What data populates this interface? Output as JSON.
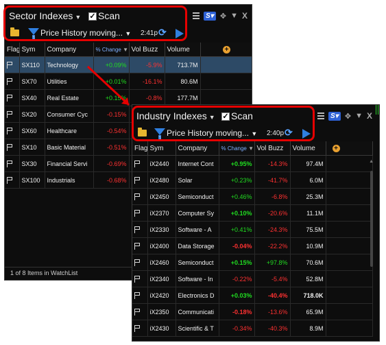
{
  "sector": {
    "title": "Sector Indexes",
    "scan_label": "Scan",
    "scan_checked": true,
    "filter_label": "Price History moving...",
    "filter_count": "1",
    "time": "2:41p",
    "columns": [
      "Flag",
      "Sym",
      "Company",
      "% Change",
      "Vol Buzz",
      "Volume"
    ],
    "sorted_column": "% Change",
    "rows": [
      {
        "sym": "SX110",
        "company": "Technology",
        "change": "+0.09%",
        "vol_buzz": "-5.9%",
        "volume": "713.7M",
        "change_dir": "pos",
        "buzz_dir": "neg",
        "selected": true
      },
      {
        "sym": "SX70",
        "company": "Utilities",
        "change": "+0.01%",
        "vol_buzz": "-16.1%",
        "volume": "80.6M",
        "change_dir": "pos",
        "buzz_dir": "neg"
      },
      {
        "sym": "SX40",
        "company": "Real Estate",
        "change": "+0.15%",
        "vol_buzz": "-0.8%",
        "volume": "177.7M",
        "change_dir": "pos",
        "buzz_dir": "neg"
      },
      {
        "sym": "SX20",
        "company": "Consumer Cyc",
        "change": "-0.15%",
        "vol_buzz": "",
        "volume": "",
        "change_dir": "neg",
        "buzz_dir": "neg"
      },
      {
        "sym": "SX60",
        "company": "Healthcare",
        "change": "-0.54%",
        "vol_buzz": "",
        "volume": "",
        "change_dir": "neg",
        "buzz_dir": "neg"
      },
      {
        "sym": "SX10",
        "company": "Basic Material",
        "change": "-0.51%",
        "vol_buzz": "",
        "volume": "",
        "change_dir": "neg",
        "buzz_dir": "neg"
      },
      {
        "sym": "SX30",
        "company": "Financial Servi",
        "change": "-0.69%",
        "vol_buzz": "",
        "volume": "",
        "change_dir": "neg",
        "buzz_dir": "neg"
      },
      {
        "sym": "SX100",
        "company": "Industrials",
        "change": "-0.68%",
        "vol_buzz": "",
        "volume": "",
        "change_dir": "neg",
        "buzz_dir": "neg"
      }
    ],
    "status": "1 of 8 Items in WatchList"
  },
  "industry": {
    "title": "Industry Indexes",
    "scan_label": "Scan",
    "scan_checked": true,
    "filter_label": "Price History moving...",
    "filter_count": "1",
    "time": "2:40p",
    "columns": [
      "Flag",
      "Sym",
      "Company",
      "% Change",
      "Vol Buzz",
      "Volume"
    ],
    "sorted_column": "% Change",
    "rows": [
      {
        "sym": "iX2440",
        "company": "Internet Cont",
        "change": "+0.95%",
        "vol_buzz": "-14.3%",
        "volume": "97.4M",
        "change_dir": "pos",
        "buzz_dir": "neg",
        "change_bold": true
      },
      {
        "sym": "iX2480",
        "company": "Solar",
        "change": "+0.23%",
        "vol_buzz": "-41.7%",
        "volume": "6.0M",
        "change_dir": "pos",
        "buzz_dir": "neg"
      },
      {
        "sym": "iX2450",
        "company": "Semiconduct",
        "change": "+0.46%",
        "vol_buzz": "-6.8%",
        "volume": "25.3M",
        "change_dir": "pos",
        "buzz_dir": "neg"
      },
      {
        "sym": "iX2370",
        "company": "Computer Sy",
        "change": "+0.10%",
        "vol_buzz": "-20.6%",
        "volume": "11.1M",
        "change_dir": "pos",
        "buzz_dir": "neg",
        "change_bold": true
      },
      {
        "sym": "iX2330",
        "company": "Software - A",
        "change": "+0.41%",
        "vol_buzz": "-24.3%",
        "volume": "75.5M",
        "change_dir": "pos",
        "buzz_dir": "neg"
      },
      {
        "sym": "iX2400",
        "company": "Data Storage",
        "change": "-0.04%",
        "vol_buzz": "-22.2%",
        "volume": "10.9M",
        "change_dir": "neg",
        "buzz_dir": "neg",
        "change_bold": true
      },
      {
        "sym": "iX2460",
        "company": "Semiconduct",
        "change": "+0.15%",
        "vol_buzz": "+97.8%",
        "volume": "70.6M",
        "change_dir": "pos",
        "buzz_dir": "pos",
        "change_bold": true
      },
      {
        "sym": "iX2340",
        "company": "Software - In",
        "change": "-0.22%",
        "vol_buzz": "-5.4%",
        "volume": "52.8M",
        "change_dir": "neg",
        "buzz_dir": "neg"
      },
      {
        "sym": "iX2420",
        "company": "Electronics D",
        "change": "+0.03%",
        "vol_buzz": "-40.4%",
        "volume": "718.0K",
        "change_dir": "pos",
        "buzz_dir": "neg",
        "change_bold": true,
        "buzz_bold": true,
        "volume_bold": true
      },
      {
        "sym": "iX2350",
        "company": "Communicati",
        "change": "-0.18%",
        "vol_buzz": "-13.6%",
        "volume": "65.9M",
        "change_dir": "neg",
        "buzz_dir": "neg",
        "change_bold": true
      },
      {
        "sym": "iX2430",
        "company": "Scientific & T",
        "change": "-0.34%",
        "vol_buzz": "-40.3%",
        "volume": "8.9M",
        "change_dir": "neg",
        "buzz_dir": "neg"
      }
    ]
  },
  "colors": {
    "positive": "#21dd21",
    "negative": "#ff3131",
    "highlight": "#e60000",
    "selected_row": "#2d4a66",
    "accent": "#2f7fe0"
  },
  "icons": [
    "menu-icon",
    "s-icon",
    "move-icon",
    "close-icon",
    "folder-icon",
    "filter-icon",
    "refresh-icon",
    "play-icon",
    "flag-icon",
    "add-column-icon"
  ]
}
